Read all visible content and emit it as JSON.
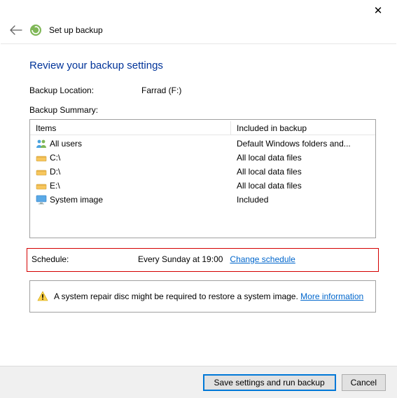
{
  "window": {
    "title": "Set up backup"
  },
  "page": {
    "heading": "Review your backup settings",
    "backup_location_label": "Backup Location:",
    "backup_location_value": "Farrad (F:)",
    "summary_label": "Backup Summary:"
  },
  "grid": {
    "col_items": "Items",
    "col_included": "Included in backup",
    "rows": [
      {
        "icon": "users",
        "item": "All users",
        "included": "Default Windows folders and..."
      },
      {
        "icon": "drive",
        "item": "C:\\",
        "included": "All local data files"
      },
      {
        "icon": "drive",
        "item": "D:\\",
        "included": "All local data files"
      },
      {
        "icon": "drive",
        "item": "E:\\",
        "included": "All local data files"
      },
      {
        "icon": "monitor",
        "item": "System image",
        "included": "Included"
      }
    ]
  },
  "schedule": {
    "label": "Schedule:",
    "value": "Every Sunday at 19:00",
    "change_link": "Change schedule"
  },
  "info": {
    "text": "A system repair disc might be required to restore a system image. ",
    "link": "More information"
  },
  "buttons": {
    "primary": "Save settings and run backup",
    "cancel": "Cancel"
  }
}
